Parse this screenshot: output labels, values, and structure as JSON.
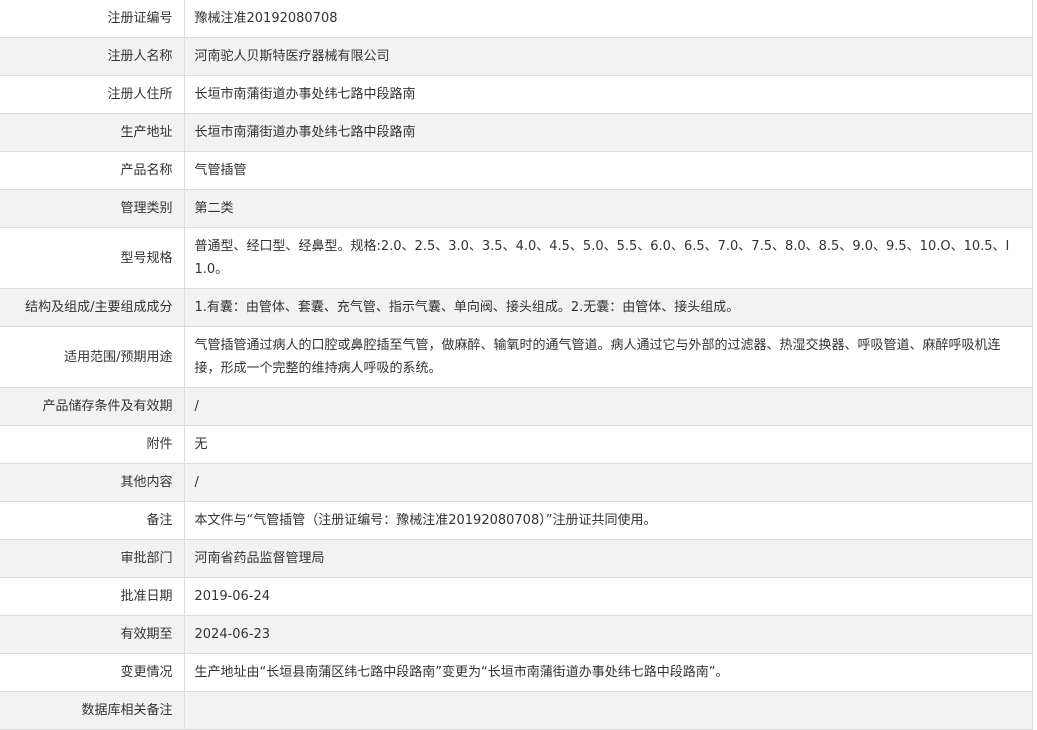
{
  "rows": [
    {
      "label": "注册证编号",
      "value": "豫械注准20192080708"
    },
    {
      "label": "注册人名称",
      "value": "河南驼人贝斯特医疗器械有限公司"
    },
    {
      "label": "注册人住所",
      "value": "长垣市南蒲街道办事处纬七路中段路南"
    },
    {
      "label": "生产地址",
      "value": "长垣市南蒲街道办事处纬七路中段路南"
    },
    {
      "label": "产品名称",
      "value": "气管插管"
    },
    {
      "label": "管理类别",
      "value": "第二类"
    },
    {
      "label": "型号规格",
      "value": "普通型、经口型、经鼻型。规格:2.0、2.5、3.0、3.5、4.0、4.5、5.0、5.5、6.0、6.5、7.0、7.5、8.0、8.5、9.0、9.5、10.O、10.5、I1.0。"
    },
    {
      "label": "结构及组成/主要组成成分",
      "value": "1.有囊：由管体、套囊、充气管、指示气囊、单向阀、接头组成。2.无囊：由管体、接头组成。"
    },
    {
      "label": "适用范围/预期用途",
      "value": "气管插管通过病人的口腔或鼻腔插至气管，做麻醉、输氧时的通气管道。病人通过它与外部的过滤器、热湿交换器、呼吸管道、麻醉呼吸机连接，形成一个完整的维持病人呼吸的系统。"
    },
    {
      "label": "产品储存条件及有效期",
      "value": "/"
    },
    {
      "label": "附件",
      "value": "无"
    },
    {
      "label": "其他内容",
      "value": "/"
    },
    {
      "label": "备注",
      "value": "本文件与“气管插管（注册证编号：豫械注准20192080708）”注册证共同使用。"
    },
    {
      "label": "审批部门",
      "value": "河南省药品监督管理局"
    },
    {
      "label": "批准日期",
      "value": "2019-06-24"
    },
    {
      "label": "有效期至",
      "value": "2024-06-23"
    },
    {
      "label": "变更情况",
      "value": "生产地址由“长垣县南蒲区纬七路中段路南”变更为“长垣市南蒲街道办事处纬七路中段路南”。"
    },
    {
      "label": "数据库相关备注",
      "value": ""
    }
  ],
  "colors": {
    "alt_row_bg": "#f2f2f2",
    "border": "#dcdcdc",
    "text": "#333333"
  }
}
